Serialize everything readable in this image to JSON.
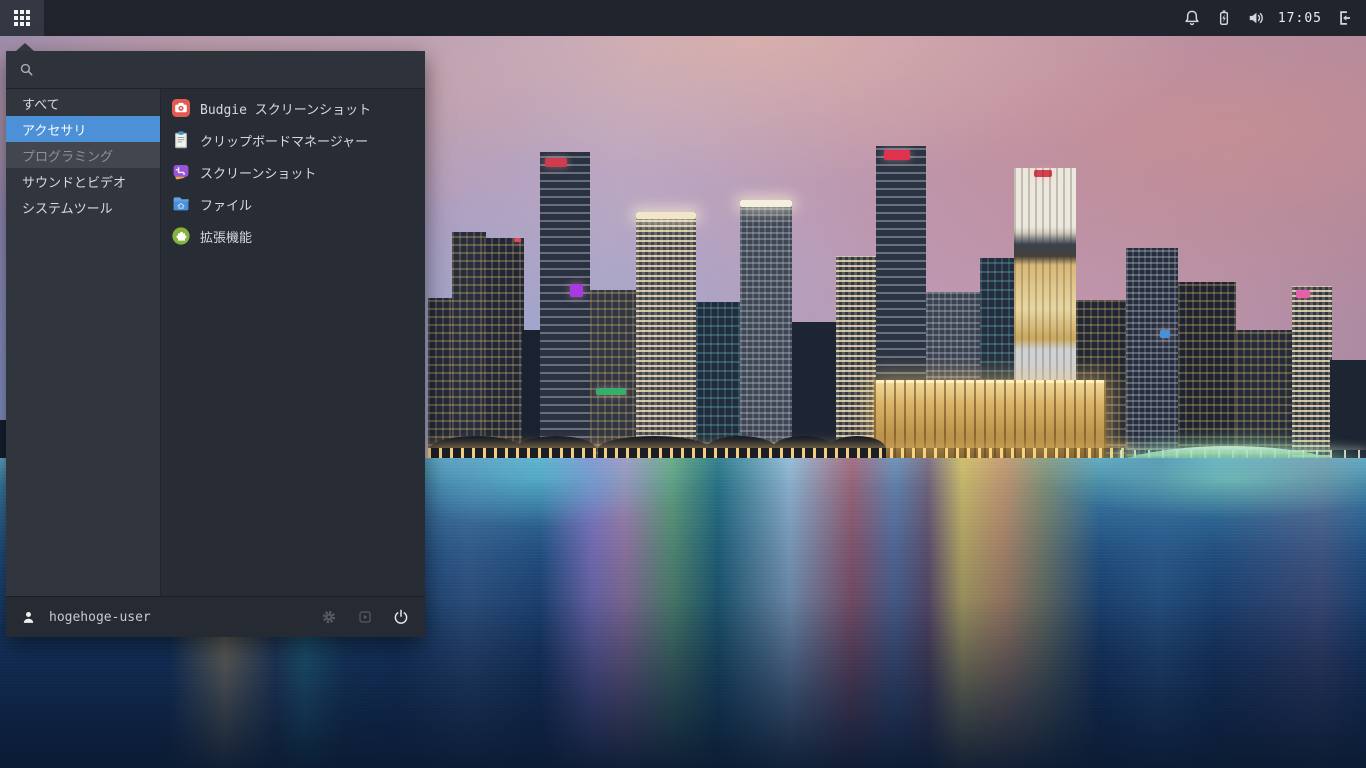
{
  "panel": {
    "clock": "17:05",
    "tray_icons": [
      "notifications-icon",
      "battery-charging-icon",
      "volume-icon",
      "raven-toggle-icon"
    ],
    "app_grid_icon": "app-grid-icon"
  },
  "menu": {
    "search": {
      "value": "",
      "placeholder": "",
      "icon": "search-icon"
    },
    "categories": [
      {
        "label": "すべて",
        "state": "normal"
      },
      {
        "label": "アクセサリ",
        "state": "selected"
      },
      {
        "label": "プログラミング",
        "state": "disabled"
      },
      {
        "label": "サウンドとビデオ",
        "state": "normal"
      },
      {
        "label": "システムツール",
        "state": "normal"
      }
    ],
    "apps": [
      {
        "label": "Budgie スクリーンショット",
        "icon": "budgie-screenshot-icon"
      },
      {
        "label": "クリップボードマネージャー",
        "icon": "clipboard-icon"
      },
      {
        "label": "スクリーンショット",
        "icon": "screenshot-icon"
      },
      {
        "label": "ファイル",
        "icon": "files-icon"
      },
      {
        "label": "拡張機能",
        "icon": "extensions-icon"
      }
    ],
    "footer": {
      "username": "hogehoge-user",
      "user_icon": "user-icon",
      "buttons": [
        {
          "icon": "settings-gear-icon",
          "style": "dim"
        },
        {
          "icon": "restart-icon",
          "style": "dim"
        },
        {
          "icon": "power-icon",
          "style": "bright"
        }
      ]
    }
  },
  "colors": {
    "accent_selected": "#4c90d8",
    "panel_bg": "#21242c",
    "menu_bg": "#282c35",
    "category_hover_bg": "#42464f"
  }
}
